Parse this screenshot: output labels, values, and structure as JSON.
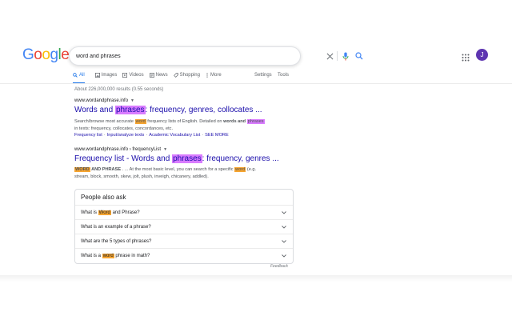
{
  "logo": {
    "letters": [
      "G",
      "o",
      "o",
      "g",
      "l",
      "e"
    ],
    "colors": [
      "#4285f4",
      "#ea4335",
      "#fbbc05",
      "#4285f4",
      "#34a853",
      "#ea4335"
    ]
  },
  "search": {
    "query": "word and phrases"
  },
  "account": {
    "initial": "J",
    "color": "#5e35b1"
  },
  "tabs": [
    {
      "label": "All",
      "icon": "search-icon",
      "active": true
    },
    {
      "label": "Images",
      "icon": "image-icon"
    },
    {
      "label": "Videos",
      "icon": "video-icon"
    },
    {
      "label": "News",
      "icon": "news-icon"
    },
    {
      "label": "Shopping",
      "icon": "tag-icon"
    },
    {
      "label": "More",
      "icon": "more-vertical-icon"
    }
  ],
  "settings_label": "Settings",
  "tools_label": "Tools",
  "result_stats": "About 226,000,000 results (0.55 seconds)",
  "results": [
    {
      "cite": "www.wordandphrase.info",
      "title_a": "Words and ",
      "title_hl": "phrases",
      "title_b": ": frequency, genres, collocates ...",
      "snippet_l1_a": "Search/browse most accurate ",
      "snippet_l1_hl1": "word",
      "snippet_l1_b": " frequency lists of English. Detailed on ",
      "snippet_l1_bold": "words and",
      "snippet_l1_hl2": "phrases",
      "snippet_l2": "in texts: frequency, collocates, concordances, etc.",
      "sitelinks": [
        "Frequency list",
        "Input/analyze texts",
        "Academic Vocabulary List",
        "SEE MORE"
      ]
    },
    {
      "cite": "www.wordandphrase.info › frequencyList",
      "title_a": "Frequency list - Words and ",
      "title_hl": "phrases",
      "title_b": ": frequency, genres ...",
      "snippet_l1_hl1": "WORD",
      "snippet_l1_a": " AND PHRASE",
      "snippet_l1_b": " . ... At the most basic level, you can search for a specific ",
      "snippet_l1_hl2": "word",
      "snippet_l1_c": " (e.g.",
      "snippet_l2": "stream, block, smooth, skew, jolt, plush, inveigh, chicanery, addled)."
    }
  ],
  "paa": {
    "title": "People also ask",
    "questions": [
      {
        "a": "What is ",
        "hl": "Word",
        "b": " and Phrase?"
      },
      {
        "a": "What is an example of a phrase?",
        "hl": "",
        "b": ""
      },
      {
        "a": "What are the 5 types of phrases?",
        "hl": "",
        "b": ""
      },
      {
        "a": "What is a ",
        "hl": "word",
        "b": " phrase in math?"
      }
    ]
  },
  "feedback_label": "Feedback"
}
